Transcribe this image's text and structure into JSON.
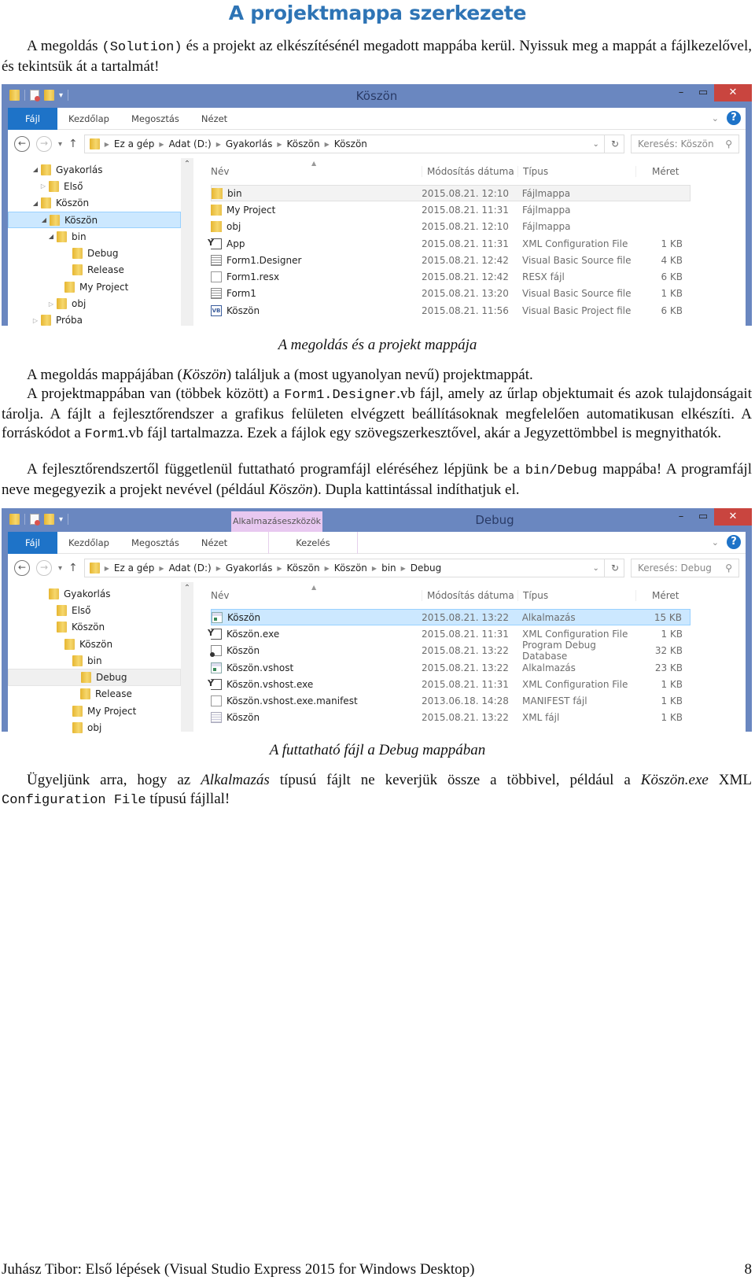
{
  "page": {
    "title": "A projektmappa szerkezete",
    "intro_a": "A megoldás ",
    "intro_mono": "(Solution)",
    "intro_b": " és a projekt az elkészítésénél megadott mappába kerül. Nyissuk meg a mappát a fájlkezelővel, és tekintsük át a tartalmát!",
    "caption1": "A megoldás és a projekt mappája",
    "p2_a": "A megoldás mappájában (",
    "p2_it": "Köszön",
    "p2_b": ") találjuk a (most ugyanolyan nevű) projektmappát.",
    "p3_a": "A projektmappában van (többek között) a ",
    "p3_mono1": "Form1.Designer",
    "p3_b": ".vb fájl, amely az űrlap objektumait és azok tulajdonságait tárolja. A fájlt a fejlesztőrendszer a grafikus felületen elvégzett beállításoknak megfelelően automatikusan elkészíti. A forráskódot a ",
    "p3_mono2": "Form1",
    "p3_c": ".vb fájl tartalmazza. Ezek a fájlok egy szövegszerkesztővel, akár a Jegyzettömbbel is megnyithatók.",
    "p4_a": "A fejlesztőrendszertől függetlenül futtatható programfájl eléréséhez lépjünk be a ",
    "p4_mono": "bin/Debug",
    "p4_b": " mappába! A programfájl neve megegyezik a projekt nevével (például ",
    "p4_it": "Köszön",
    "p4_c": "). Dupla kattintással indíthatjuk el.",
    "caption2": "A futtatható fájl a Debug mappában",
    "p5_a": "Ügyeljünk arra, hogy az ",
    "p5_it1": "Alkalmazás",
    "p5_b": " típusú fájlt ne keverjük össze a többivel, például a ",
    "p5_it2": "Köszön.exe",
    "p5_c": " XML ",
    "p5_mono": "Configuration File",
    "p5_d": " típusú fájllal!",
    "footer_left": "Juhász Tibor: Első lépések (Visual Studio Express 2015 for Windows Desktop)",
    "footer_page": "8"
  },
  "explorer1": {
    "window_title": "Köszön",
    "tabs": [
      "Fájl",
      "Kezdőlap",
      "Megosztás",
      "Nézet"
    ],
    "breadcrumb": [
      "Ez a gép",
      "Adat (D:)",
      "Gyakorlás",
      "Köszön",
      "Köszön"
    ],
    "search_placeholder": "Keresés: Köszön",
    "columns": [
      "Név",
      "Módosítás dátuma",
      "Típus",
      "Méret"
    ],
    "tree": [
      {
        "label": "Gyakorlás",
        "exp": "◢"
      },
      {
        "label": "Első",
        "exp": "▷"
      },
      {
        "label": "Köszön",
        "exp": "◢"
      },
      {
        "label": "Köszön",
        "exp": "◢"
      },
      {
        "label": "bin",
        "exp": "◢"
      },
      {
        "label": "Debug",
        "exp": ""
      },
      {
        "label": "Release",
        "exp": ""
      },
      {
        "label": "My Project",
        "exp": ""
      },
      {
        "label": "obj",
        "exp": "▷"
      },
      {
        "label": "Próba",
        "exp": "▷"
      }
    ],
    "files": [
      {
        "name": "bin",
        "date": "2015.08.21. 12:10",
        "type": "Fájlmappa",
        "size": "",
        "icon": "folder"
      },
      {
        "name": "My Project",
        "date": "2015.08.21. 11:31",
        "type": "Fájlmappa",
        "size": "",
        "icon": "folder"
      },
      {
        "name": "obj",
        "date": "2015.08.21. 12:10",
        "type": "Fájlmappa",
        "size": "",
        "icon": "folder"
      },
      {
        "name": "App",
        "date": "2015.08.21. 11:31",
        "type": "XML Configuration File",
        "size": "1 KB",
        "icon": "config"
      },
      {
        "name": "Form1.Designer",
        "date": "2015.08.21. 12:42",
        "type": "Visual Basic Source file",
        "size": "4 KB",
        "icon": "document-lines"
      },
      {
        "name": "Form1.resx",
        "date": "2015.08.21. 12:42",
        "type": "RESX fájl",
        "size": "6 KB",
        "icon": "document"
      },
      {
        "name": "Form1",
        "date": "2015.08.21. 13:20",
        "type": "Visual Basic Source file",
        "size": "1 KB",
        "icon": "document-lines"
      },
      {
        "name": "Köszön",
        "date": "2015.08.21. 11:56",
        "type": "Visual Basic Project file",
        "size": "6 KB",
        "icon": "vb-project"
      }
    ]
  },
  "explorer2": {
    "window_title": "Debug",
    "context_tab_group": "Alkalmazáseszközök",
    "tabs": [
      "Fájl",
      "Kezdőlap",
      "Megosztás",
      "Nézet",
      "Kezelés"
    ],
    "breadcrumb": [
      "Ez a gép",
      "Adat (D:)",
      "Gyakorlás",
      "Köszön",
      "Köszön",
      "bin",
      "Debug"
    ],
    "search_placeholder": "Keresés: Debug",
    "columns": [
      "Név",
      "Módosítás dátuma",
      "Típus",
      "Méret"
    ],
    "tree": [
      {
        "label": "Gyakorlás"
      },
      {
        "label": "Első"
      },
      {
        "label": "Köszön"
      },
      {
        "label": "Köszön"
      },
      {
        "label": "bin"
      },
      {
        "label": "Debug"
      },
      {
        "label": "Release"
      },
      {
        "label": "My Project"
      },
      {
        "label": "obj"
      }
    ],
    "files": [
      {
        "name": "Köszön",
        "date": "2015.08.21. 13:22",
        "type": "Alkalmazás",
        "size": "15 KB",
        "icon": "application"
      },
      {
        "name": "Köszön.exe",
        "date": "2015.08.21. 11:31",
        "type": "XML Configuration File",
        "size": "1 KB",
        "icon": "config"
      },
      {
        "name": "Köszön",
        "date": "2015.08.21. 13:22",
        "type": "Program Debug Database",
        "size": "32 KB",
        "icon": "pdb"
      },
      {
        "name": "Köszön.vshost",
        "date": "2015.08.21. 13:22",
        "type": "Alkalmazás",
        "size": "23 KB",
        "icon": "application"
      },
      {
        "name": "Köszön.vshost.exe",
        "date": "2015.08.21. 11:31",
        "type": "XML Configuration File",
        "size": "1 KB",
        "icon": "config"
      },
      {
        "name": "Köszön.vshost.exe.manifest",
        "date": "2013.06.18. 14:28",
        "type": "MANIFEST fájl",
        "size": "1 KB",
        "icon": "document"
      },
      {
        "name": "Köszön",
        "date": "2015.08.21. 13:22",
        "type": "XML fájl",
        "size": "1 KB",
        "icon": "xml"
      }
    ]
  }
}
